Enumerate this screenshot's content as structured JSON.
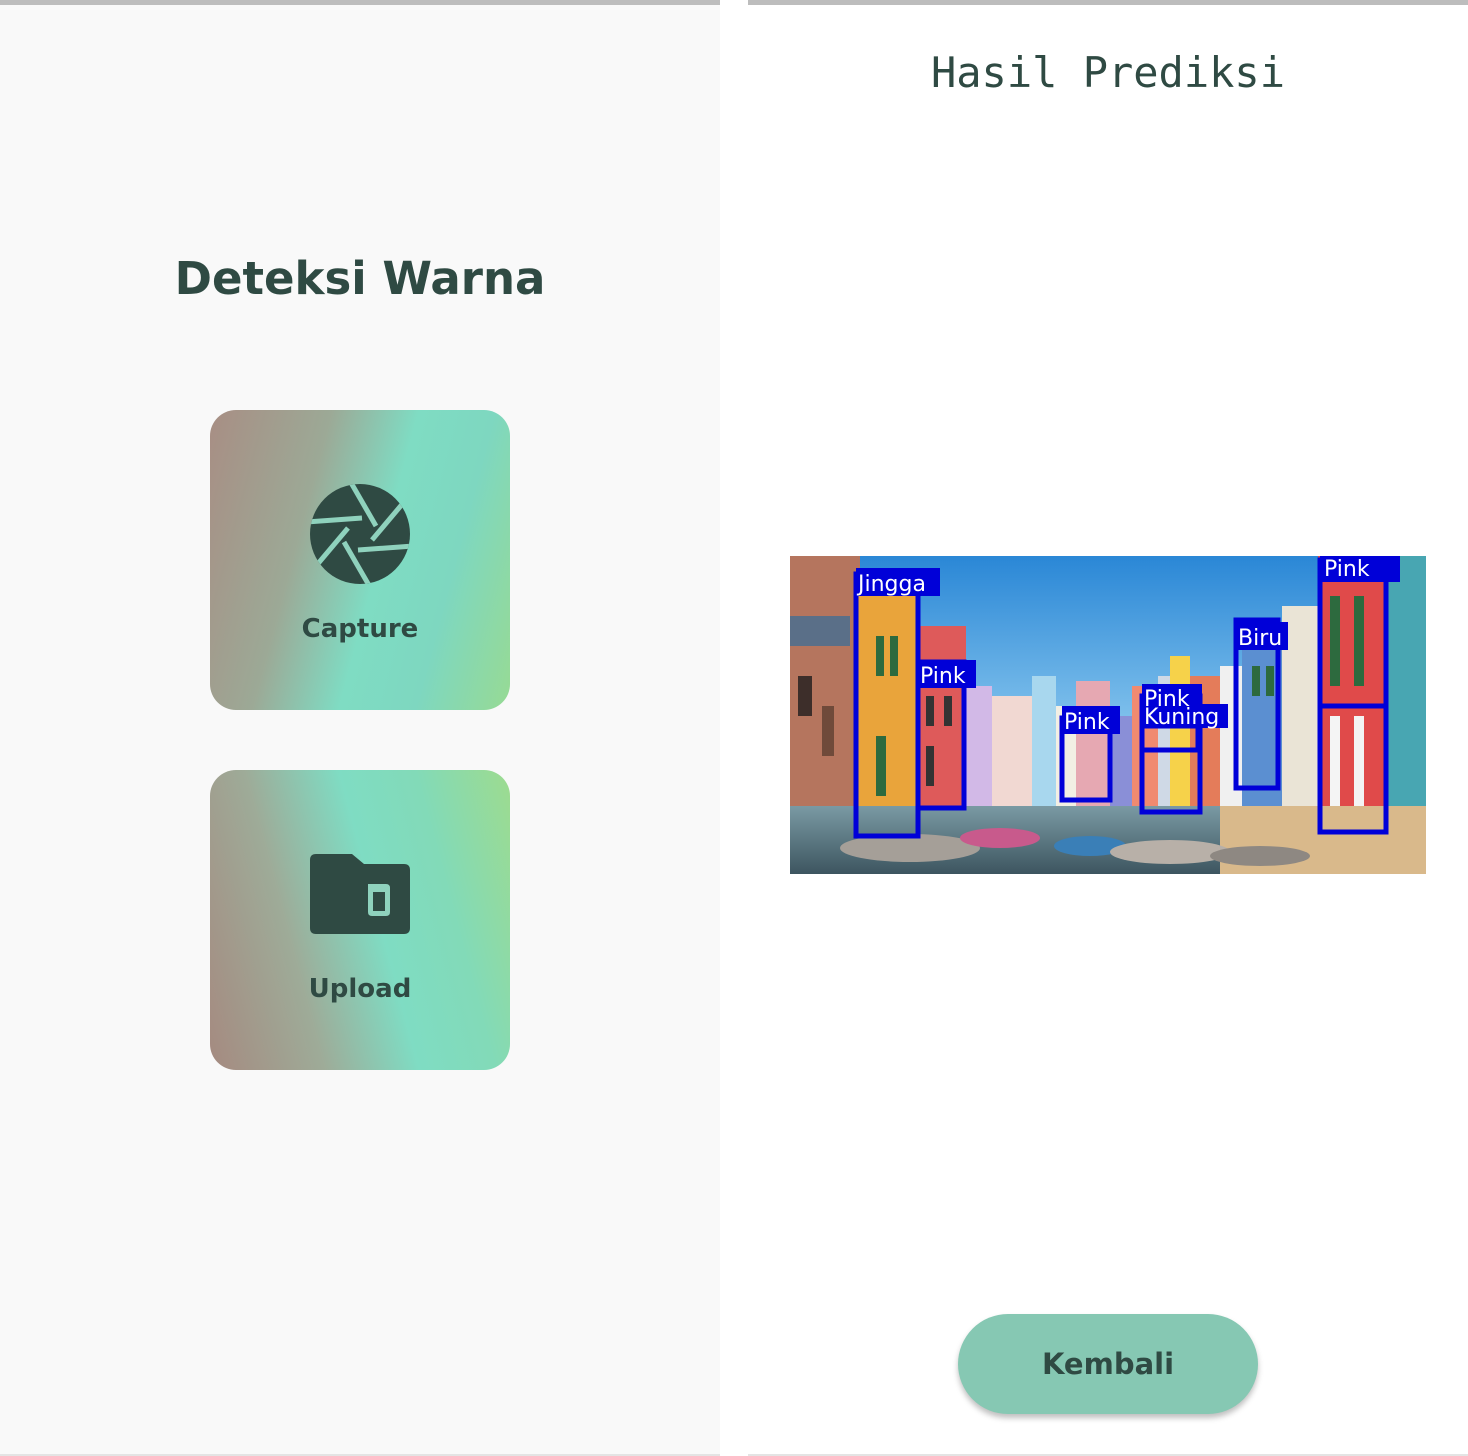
{
  "home_screen": {
    "title": "Deteksi Warna",
    "buttons": [
      {
        "label": "Capture",
        "icon": "camera-shutter-icon"
      },
      {
        "label": "Upload",
        "icon": "folder-file-icon"
      }
    ]
  },
  "result_screen": {
    "title": "Hasil Prediksi",
    "detections": [
      "Jingga",
      "Pink",
      "Pink",
      "Pink",
      "Kuning",
      "Biru",
      "Pink"
    ],
    "back_label": "Kembali"
  },
  "colors": {
    "text_dark": "#2f4a43",
    "button_teal": "#86c8b3",
    "box_blue": "#0000d8",
    "card_gradient": [
      "#a88e84",
      "#7fdcc3",
      "#97da94"
    ]
  }
}
